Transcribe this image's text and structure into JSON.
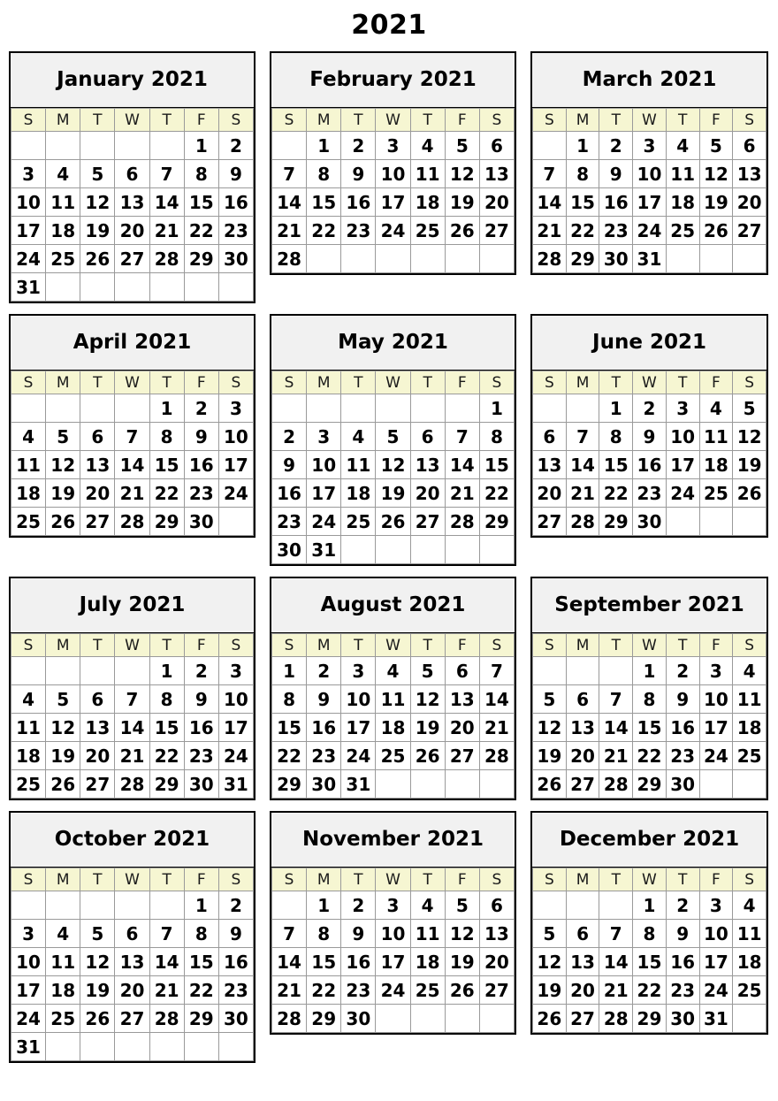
{
  "page": {
    "title": "2021"
  },
  "weekday_headers": [
    "S",
    "M",
    "T",
    "W",
    "T",
    "F",
    "S"
  ],
  "colors": {
    "page_background": "#ffffff",
    "month_title_background": "#f1f1f1",
    "weekday_header_background": "#f6f6d2",
    "cell_border": "#9a9a9a",
    "month_border": "#000000",
    "text": "#000000"
  },
  "months": [
    {
      "name": "January",
      "year": "2021",
      "title": "January 2021",
      "weeks": [
        [
          "",
          "",
          "",
          "",
          "",
          "1",
          "2"
        ],
        [
          "3",
          "4",
          "5",
          "6",
          "7",
          "8",
          "9"
        ],
        [
          "10",
          "11",
          "12",
          "13",
          "14",
          "15",
          "16"
        ],
        [
          "17",
          "18",
          "19",
          "20",
          "21",
          "22",
          "23"
        ],
        [
          "24",
          "25",
          "26",
          "27",
          "28",
          "29",
          "30"
        ],
        [
          "31",
          "",
          "",
          "",
          "",
          "",
          ""
        ]
      ]
    },
    {
      "name": "February",
      "year": "2021",
      "title": "February 2021",
      "weeks": [
        [
          "",
          "1",
          "2",
          "3",
          "4",
          "5",
          "6"
        ],
        [
          "7",
          "8",
          "9",
          "10",
          "11",
          "12",
          "13"
        ],
        [
          "14",
          "15",
          "16",
          "17",
          "18",
          "19",
          "20"
        ],
        [
          "21",
          "22",
          "23",
          "24",
          "25",
          "26",
          "27"
        ],
        [
          "28",
          "",
          "",
          "",
          "",
          "",
          ""
        ]
      ]
    },
    {
      "name": "March",
      "year": "2021",
      "title": "March 2021",
      "weeks": [
        [
          "",
          "1",
          "2",
          "3",
          "4",
          "5",
          "6"
        ],
        [
          "7",
          "8",
          "9",
          "10",
          "11",
          "12",
          "13"
        ],
        [
          "14",
          "15",
          "16",
          "17",
          "18",
          "19",
          "20"
        ],
        [
          "21",
          "22",
          "23",
          "24",
          "25",
          "26",
          "27"
        ],
        [
          "28",
          "29",
          "30",
          "31",
          "",
          "",
          ""
        ]
      ]
    },
    {
      "name": "April",
      "year": "2021",
      "title": "April 2021",
      "weeks": [
        [
          "",
          "",
          "",
          "",
          "1",
          "2",
          "3"
        ],
        [
          "4",
          "5",
          "6",
          "7",
          "8",
          "9",
          "10"
        ],
        [
          "11",
          "12",
          "13",
          "14",
          "15",
          "16",
          "17"
        ],
        [
          "18",
          "19",
          "20",
          "21",
          "22",
          "23",
          "24"
        ],
        [
          "25",
          "26",
          "27",
          "28",
          "29",
          "30",
          ""
        ]
      ]
    },
    {
      "name": "May",
      "year": "2021",
      "title": "May 2021",
      "weeks": [
        [
          "",
          "",
          "",
          "",
          "",
          "",
          "1"
        ],
        [
          "2",
          "3",
          "4",
          "5",
          "6",
          "7",
          "8"
        ],
        [
          "9",
          "10",
          "11",
          "12",
          "13",
          "14",
          "15"
        ],
        [
          "16",
          "17",
          "18",
          "19",
          "20",
          "21",
          "22"
        ],
        [
          "23",
          "24",
          "25",
          "26",
          "27",
          "28",
          "29"
        ],
        [
          "30",
          "31",
          "",
          "",
          "",
          "",
          ""
        ]
      ]
    },
    {
      "name": "June",
      "year": "2021",
      "title": "June 2021",
      "weeks": [
        [
          "",
          "",
          "1",
          "2",
          "3",
          "4",
          "5"
        ],
        [
          "6",
          "7",
          "8",
          "9",
          "10",
          "11",
          "12"
        ],
        [
          "13",
          "14",
          "15",
          "16",
          "17",
          "18",
          "19"
        ],
        [
          "20",
          "21",
          "22",
          "23",
          "24",
          "25",
          "26"
        ],
        [
          "27",
          "28",
          "29",
          "30",
          "",
          "",
          ""
        ]
      ]
    },
    {
      "name": "July",
      "year": "2021",
      "title": "July 2021",
      "weeks": [
        [
          "",
          "",
          "",
          "",
          "1",
          "2",
          "3"
        ],
        [
          "4",
          "5",
          "6",
          "7",
          "8",
          "9",
          "10"
        ],
        [
          "11",
          "12",
          "13",
          "14",
          "15",
          "16",
          "17"
        ],
        [
          "18",
          "19",
          "20",
          "21",
          "22",
          "23",
          "24"
        ],
        [
          "25",
          "26",
          "27",
          "28",
          "29",
          "30",
          "31"
        ]
      ]
    },
    {
      "name": "August",
      "year": "2021",
      "title": "August 2021",
      "weeks": [
        [
          "1",
          "2",
          "3",
          "4",
          "5",
          "6",
          "7"
        ],
        [
          "8",
          "9",
          "10",
          "11",
          "12",
          "13",
          "14"
        ],
        [
          "15",
          "16",
          "17",
          "18",
          "19",
          "20",
          "21"
        ],
        [
          "22",
          "23",
          "24",
          "25",
          "26",
          "27",
          "28"
        ],
        [
          "29",
          "30",
          "31",
          "",
          "",
          "",
          ""
        ]
      ]
    },
    {
      "name": "September",
      "year": "2021",
      "title": "September 2021",
      "weeks": [
        [
          "",
          "",
          "",
          "1",
          "2",
          "3",
          "4"
        ],
        [
          "5",
          "6",
          "7",
          "8",
          "9",
          "10",
          "11"
        ],
        [
          "12",
          "13",
          "14",
          "15",
          "16",
          "17",
          "18"
        ],
        [
          "19",
          "20",
          "21",
          "22",
          "23",
          "24",
          "25"
        ],
        [
          "26",
          "27",
          "28",
          "29",
          "30",
          "",
          ""
        ]
      ]
    },
    {
      "name": "October",
      "year": "2021",
      "title": "October 2021",
      "weeks": [
        [
          "",
          "",
          "",
          "",
          "",
          "1",
          "2"
        ],
        [
          "3",
          "4",
          "5",
          "6",
          "7",
          "8",
          "9"
        ],
        [
          "10",
          "11",
          "12",
          "13",
          "14",
          "15",
          "16"
        ],
        [
          "17",
          "18",
          "19",
          "20",
          "21",
          "22",
          "23"
        ],
        [
          "24",
          "25",
          "26",
          "27",
          "28",
          "29",
          "30"
        ],
        [
          "31",
          "",
          "",
          "",
          "",
          "",
          ""
        ]
      ]
    },
    {
      "name": "November",
      "year": "2021",
      "title": "November 2021",
      "weeks": [
        [
          "",
          "1",
          "2",
          "3",
          "4",
          "5",
          "6"
        ],
        [
          "7",
          "8",
          "9",
          "10",
          "11",
          "12",
          "13"
        ],
        [
          "14",
          "15",
          "16",
          "17",
          "18",
          "19",
          "20"
        ],
        [
          "21",
          "22",
          "23",
          "24",
          "25",
          "26",
          "27"
        ],
        [
          "28",
          "29",
          "30",
          "",
          "",
          "",
          ""
        ]
      ]
    },
    {
      "name": "December",
      "year": "2021",
      "title": "December 2021",
      "weeks": [
        [
          "",
          "",
          "",
          "1",
          "2",
          "3",
          "4"
        ],
        [
          "5",
          "6",
          "7",
          "8",
          "9",
          "10",
          "11"
        ],
        [
          "12",
          "13",
          "14",
          "15",
          "16",
          "17",
          "18"
        ],
        [
          "19",
          "20",
          "21",
          "22",
          "23",
          "24",
          "25"
        ],
        [
          "26",
          "27",
          "28",
          "29",
          "30",
          "31",
          ""
        ]
      ]
    }
  ]
}
